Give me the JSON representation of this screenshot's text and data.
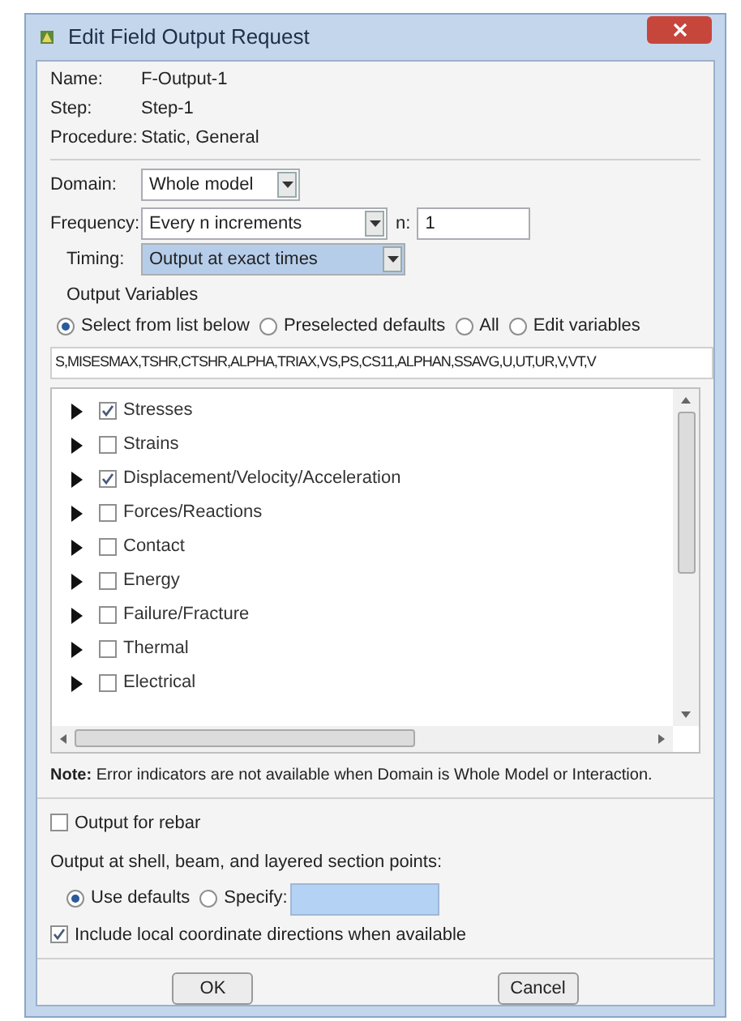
{
  "window": {
    "title": "Edit Field Output Request"
  },
  "info": [
    {
      "label": "Name:",
      "value": "F-Output-1"
    },
    {
      "label": "Step:",
      "value": "Step-1"
    },
    {
      "label": "Procedure:",
      "value": "Static, General"
    }
  ],
  "domain": {
    "label": "Domain:",
    "value": "Whole model"
  },
  "frequency": {
    "label": "Frequency:",
    "value": "Every n increments",
    "n_label": "n:",
    "n_value": "1"
  },
  "timing": {
    "label": "Timing:",
    "value": "Output at exact times"
  },
  "output_variables": {
    "title": "Output Variables",
    "options": [
      {
        "label": "Select from list below",
        "selected": true
      },
      {
        "label": "Preselected defaults",
        "selected": false
      },
      {
        "label": "All",
        "selected": false
      },
      {
        "label": "Edit variables",
        "selected": false
      }
    ],
    "variables": "S,MISESMAX,TSHR,CTSHR,ALPHA,TRIAX,VS,PS,CS11,ALPHAN,SSAVG,U,UT,UR,V,VT,V",
    "tree": [
      {
        "label": "Stresses",
        "checked": true
      },
      {
        "label": "Strains",
        "checked": false
      },
      {
        "label": "Displacement/Velocity/Acceleration",
        "checked": true
      },
      {
        "label": "Forces/Reactions",
        "checked": false
      },
      {
        "label": "Contact",
        "checked": false
      },
      {
        "label": "Energy",
        "checked": false
      },
      {
        "label": "Failure/Fracture",
        "checked": false
      },
      {
        "label": "Thermal",
        "checked": false
      },
      {
        "label": "Electrical",
        "checked": false
      }
    ]
  },
  "note": "**Note:** Error indicators are not available when Domain is Whole Model or Interaction.",
  "rebar": {
    "label": "Output for rebar",
    "checked": false
  },
  "section_points": {
    "label": "Output at shell, beam, and layered section points:",
    "options": [
      {
        "label": "Use defaults",
        "selected": true
      },
      {
        "label": "Specify:",
        "selected": false
      }
    ]
  },
  "local_coords": {
    "label": "Include local coordinate directions when available",
    "checked": true
  },
  "buttons": [
    "OK",
    "Cancel"
  ]
}
